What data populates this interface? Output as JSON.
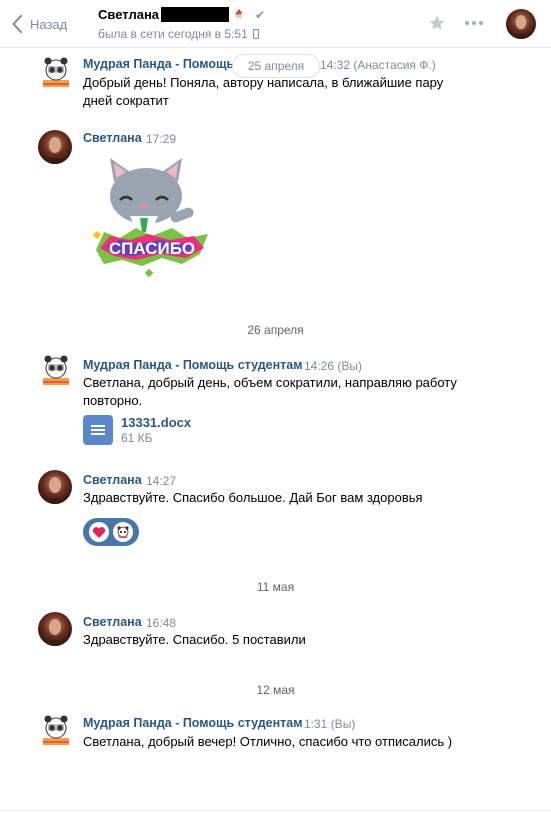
{
  "header": {
    "back_label": "Назад",
    "contact_name": "Светлана",
    "status": "была в сети сегодня в 5:51"
  },
  "floating_date": "25 апреля",
  "messages": [
    {
      "author": "Мудрая Панда - Помощь",
      "time": "14:32 (Анастасия Ф.)",
      "text_lines": [
        "Добрый день! Поняла, автору написала, в ближайшие пару",
        "дней сократит"
      ]
    },
    {
      "author": "Светлана",
      "time": "17:29",
      "sticker_text": "СПАСИБО"
    },
    {
      "author": "Мудрая Панда - Помощь студентам",
      "time": "14:26 (Вы)",
      "text_lines": [
        "Светлана, добрый день, объем сократили, направляю работу",
        "повторно."
      ],
      "attachment": {
        "name": "13331.docx",
        "size": "61 КБ"
      }
    },
    {
      "author": "Светлана",
      "time": "14:27",
      "text": "Здравствуйте. Спасибо большое. Дай Бог вам здоровья"
    },
    {
      "author": "Светлана",
      "time": "16:48",
      "text": "Здравствуйте. Спасибо. 5 поставили"
    },
    {
      "author": "Мудрая Панда - Помощь студентам",
      "time": "1:31 (Вы)",
      "text": "Светлана, добрый вечер! Отлично, спасибо что отписались )"
    }
  ],
  "date_separators": [
    "26 апреля",
    "11 мая",
    "12 мая"
  ],
  "colors": {
    "link_blue": "#2a5885",
    "muted": "#828a99",
    "accent": "#4a76a8"
  }
}
